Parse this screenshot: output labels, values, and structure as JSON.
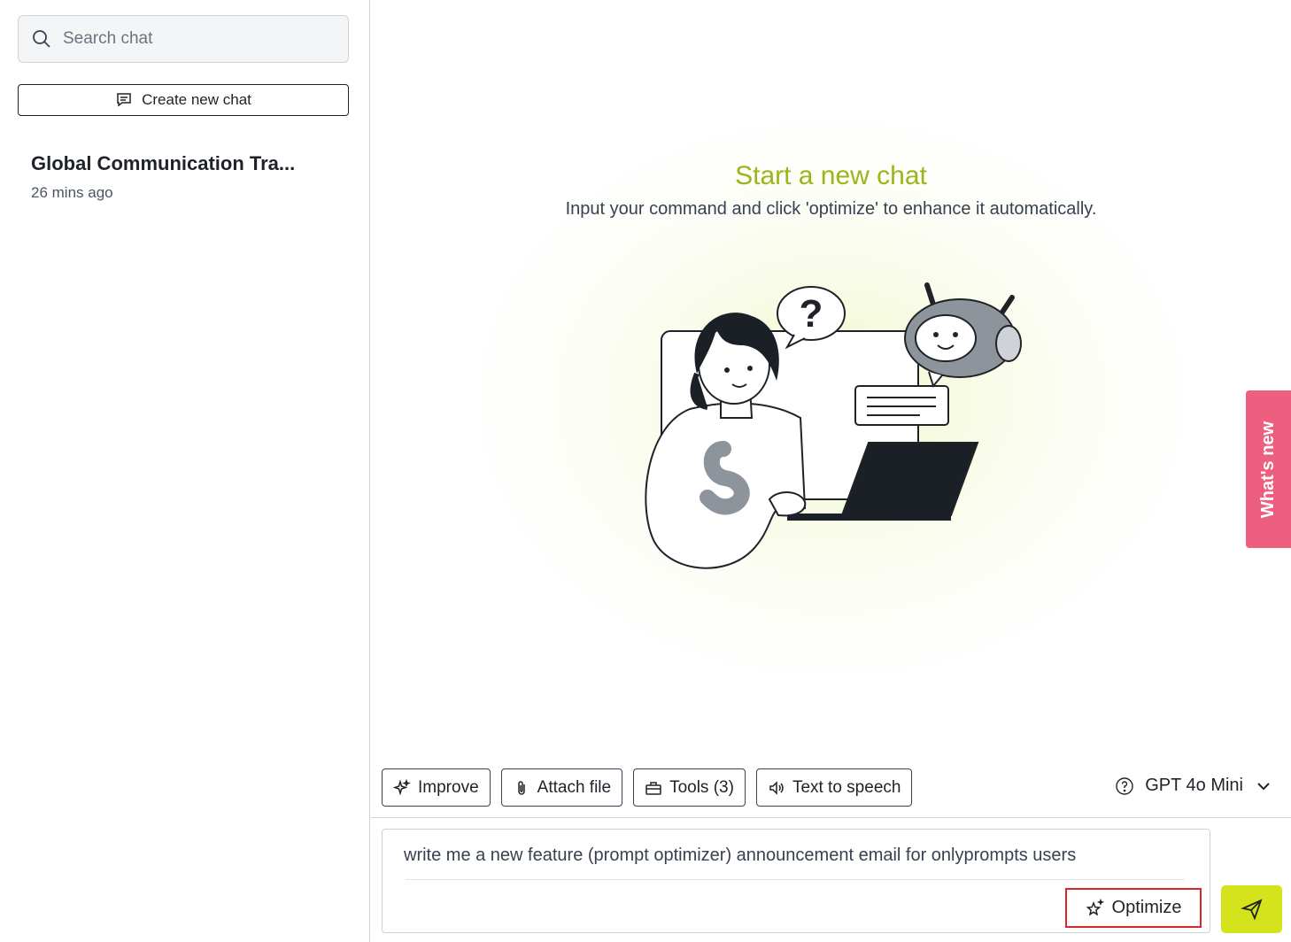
{
  "sidebar": {
    "search_placeholder": "Search chat",
    "new_chat_label": "Create new chat",
    "chats": [
      {
        "title": "Global Communication Tra...",
        "time": "26 mins ago"
      }
    ]
  },
  "main": {
    "heading": "Start a new chat",
    "subheading": "Input your command and click 'optimize' to enhance it automatically.",
    "whats_new": "What's new"
  },
  "toolbar": {
    "improve": "Improve",
    "attach": "Attach file",
    "tools": "Tools (3)",
    "tts": "Text to speech",
    "model": "GPT 4o Mini"
  },
  "composer": {
    "text": "write me a new feature (prompt optimizer) announcement email for onlyprompts users",
    "optimize": "Optimize"
  },
  "colors": {
    "accent": "#9bb51a",
    "send_bg": "#d4e31b",
    "whats_new_bg": "#ee5e7f",
    "highlight_border": "#d62828"
  }
}
